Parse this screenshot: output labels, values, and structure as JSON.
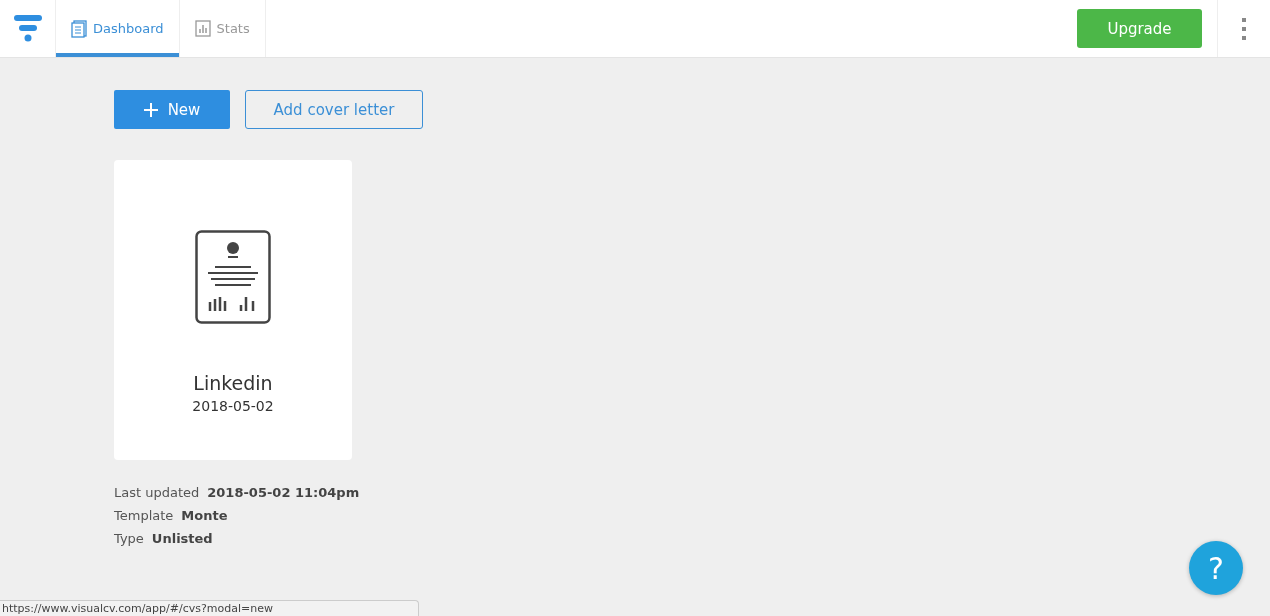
{
  "tabs": [
    {
      "label": "Dashboard",
      "kind": "document",
      "selected": true
    },
    {
      "label": "Stats",
      "kind": "chart",
      "selected": false
    }
  ],
  "upgrade_button": "Upgrade",
  "actions": {
    "new_button": "New",
    "cover_letter_button": "Add cover letter"
  },
  "cv_card": {
    "name": "Linkedin",
    "date": "2018-05-02"
  },
  "details": [
    {
      "label": "Last updated",
      "value": "2018-05-02 11:04pm"
    },
    {
      "label": "Template",
      "value": "Monte"
    },
    {
      "label": "Type",
      "value": "Unlisted"
    }
  ],
  "help_button": "?",
  "status_url": "https://www.visualcv.com/app/#/cvs?modal=new"
}
